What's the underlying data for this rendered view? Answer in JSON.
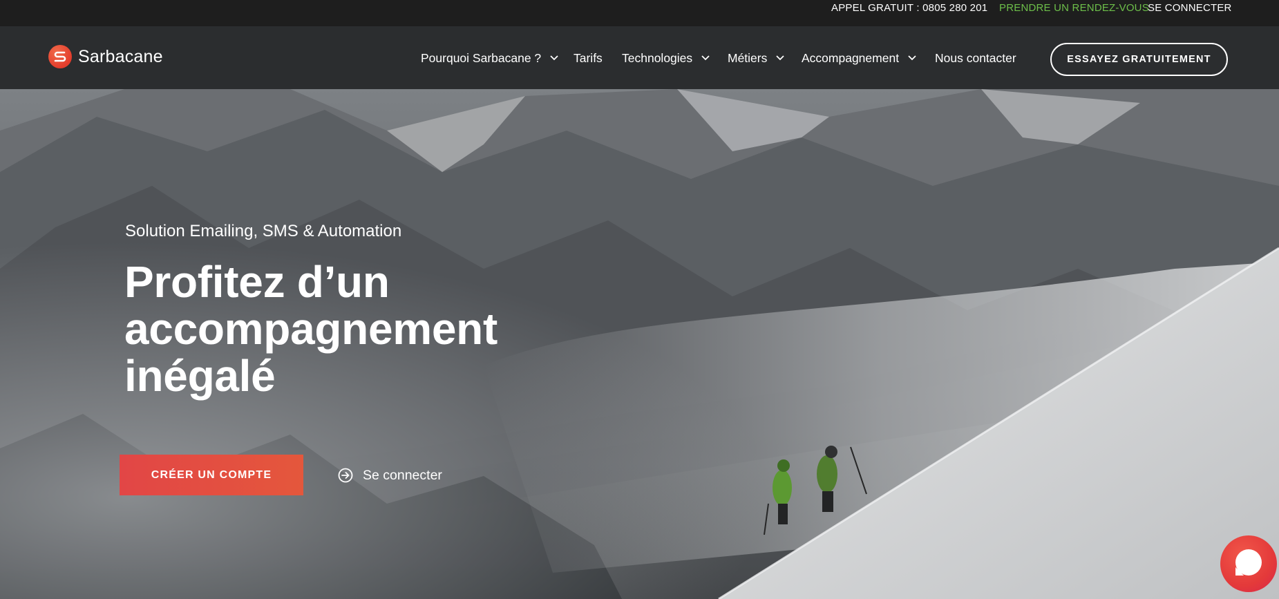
{
  "topbar": {
    "phone": "APPEL GRATUIT : 0805 280 201",
    "appointment": "PRENDRE UN RENDEZ-VOUS",
    "login": "SE CONNECTER",
    "appointment_color": "#6dbf4a"
  },
  "nav": {
    "logo_text": "Sarbacane",
    "logo_icon": "sarbacane-logo-icon",
    "items": [
      {
        "label": "Pourquoi Sarbacane ?",
        "has_dropdown": true
      },
      {
        "label": "Tarifs",
        "has_dropdown": false
      },
      {
        "label": "Technologies",
        "has_dropdown": true
      },
      {
        "label": "Métiers",
        "has_dropdown": true
      },
      {
        "label": "Accompagnement",
        "has_dropdown": true
      },
      {
        "label": "Nous contacter",
        "has_dropdown": false
      }
    ],
    "cta": "ESSAYEZ GRATUITEMENT"
  },
  "hero": {
    "subtitle": "Solution Emailing, SMS & Automation",
    "title": "Profitez d’un accompagnement inégalé",
    "primary_button": "CRÉER UN COMPTE",
    "secondary_link": "Se connecter",
    "secondary_icon": "arrow-circle-icon",
    "accent_color": "#e4503f"
  },
  "chat": {
    "icon": "chat-bubble-icon"
  }
}
